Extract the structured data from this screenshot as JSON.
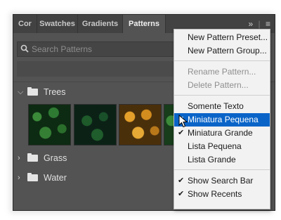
{
  "tabs": [
    {
      "label": "Cor"
    },
    {
      "label": "Swatches"
    },
    {
      "label": "Gradients"
    },
    {
      "label": "Patterns"
    }
  ],
  "active_tab": "Patterns",
  "search": {
    "placeholder": "Search Patterns"
  },
  "groups": [
    {
      "name": "Trees",
      "expanded": true
    },
    {
      "name": "Grass",
      "expanded": false
    },
    {
      "name": "Water",
      "expanded": false
    }
  ],
  "menu": {
    "items": [
      {
        "label": "New Pattern Preset...",
        "enabled": true
      },
      {
        "label": "New Pattern Group...",
        "enabled": true
      },
      {
        "label": "Rename Pattern...",
        "enabled": false
      },
      {
        "label": "Delete Pattern...",
        "enabled": false
      },
      {
        "label": "Somente Texto",
        "enabled": true
      },
      {
        "label": "Miniatura Pequena",
        "enabled": true,
        "checked": true,
        "highlighted": true
      },
      {
        "label": "Miniatura Grande",
        "enabled": true,
        "checked": true
      },
      {
        "label": "Lista Pequena",
        "enabled": true
      },
      {
        "label": "Lista Grande",
        "enabled": true
      },
      {
        "label": "Show Search Bar",
        "enabled": true,
        "checked": true
      },
      {
        "label": "Show Recents",
        "enabled": true,
        "checked": true
      }
    ]
  },
  "colors": {
    "panel_bg": "#535353",
    "tabbar_bg": "#424242",
    "menu_bg": "#f2f2f2",
    "highlight": "#0a64c8"
  },
  "icons": [
    "search-icon",
    "expand-panel-icon",
    "panel-menu-icon",
    "folder-icon",
    "chevron-down-icon",
    "chevron-right-icon",
    "checkmark-icon",
    "mouse-cursor-icon"
  ]
}
